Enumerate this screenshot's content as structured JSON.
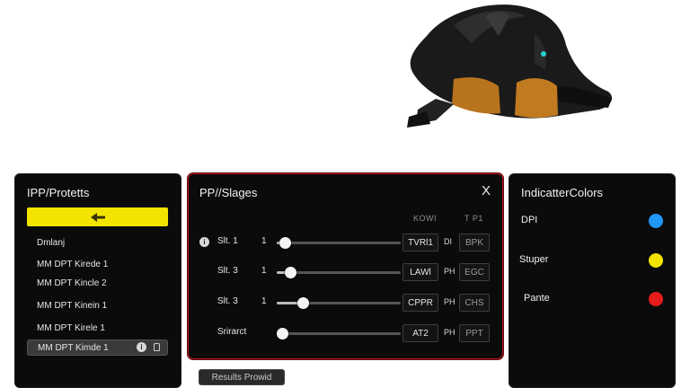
{
  "profiles_panel": {
    "title": "IPP/Protetts",
    "items": [
      {
        "label": "Dmlanj"
      },
      {
        "label": "MM DPT Kirede 1"
      },
      {
        "label": "MM DPT Kincle 2"
      },
      {
        "label": "MM DPT Kinein 1"
      },
      {
        "label": "MM DPT Kirele 1"
      },
      {
        "label": "MM DPT Kimde 1",
        "selected": true
      }
    ],
    "back_icon": "arrow-left-icon",
    "accent_color": "#f2e400"
  },
  "stages_panel": {
    "title": "PP//Slages",
    "close_label": "X",
    "col_head_1": "KOWI",
    "col_head_2": "T P1",
    "rows": [
      {
        "label": "Slt.  1",
        "num": "1",
        "level": 0.02,
        "value": "TVRl1",
        "unit": "DI",
        "value2": "BPK",
        "info": "i"
      },
      {
        "label": "Slt.  3",
        "num": "1",
        "level": 0.07,
        "value": "LAWl",
        "unit": "PH",
        "value2": "EGC"
      },
      {
        "label": "Slt.  3",
        "num": "1",
        "level": 0.18,
        "value": "CPPR",
        "unit": "PH",
        "value2": "CHS"
      },
      {
        "label": "Srirarct",
        "num": "",
        "level": 0.0,
        "value": "AT2",
        "unit": "PH",
        "value2": "PPT"
      }
    ],
    "border_color": "#c0161f"
  },
  "results_button": "Results Prowid",
  "colors_panel": {
    "title": "IndicatterColors",
    "items": [
      {
        "label": "DPI",
        "color": "#2196f3"
      },
      {
        "label": "Stuper",
        "color": "#f2e400"
      },
      {
        "label": "Pante",
        "color": "#e61b1b"
      }
    ]
  }
}
